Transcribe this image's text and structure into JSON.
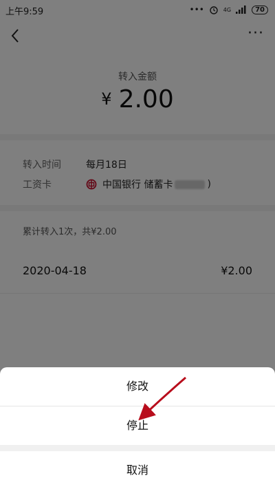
{
  "status_bar": {
    "time": "上午9:59",
    "signal": "4G",
    "battery": "70"
  },
  "header": {
    "back_icon": "chevron-left-icon",
    "more_icon": "more-dots-icon"
  },
  "transfer": {
    "amount_label": "转入金额",
    "currency": "¥",
    "amount": "2.00"
  },
  "details": {
    "time_label": "转入时间",
    "time_value": "每月18日",
    "card_label": "工资卡",
    "card_value": "中国银行 储蓄卡",
    "card_suffix": ")"
  },
  "summary": "累计转入1次，共¥2.00",
  "records": [
    {
      "date": "2020-04-18",
      "amount": "¥2.00"
    }
  ],
  "action_sheet": {
    "edit": "修改",
    "stop": "停止",
    "cancel": "取消"
  },
  "colors": {
    "bank_red": "#c8102e",
    "arrow_red": "#b80d1c"
  }
}
